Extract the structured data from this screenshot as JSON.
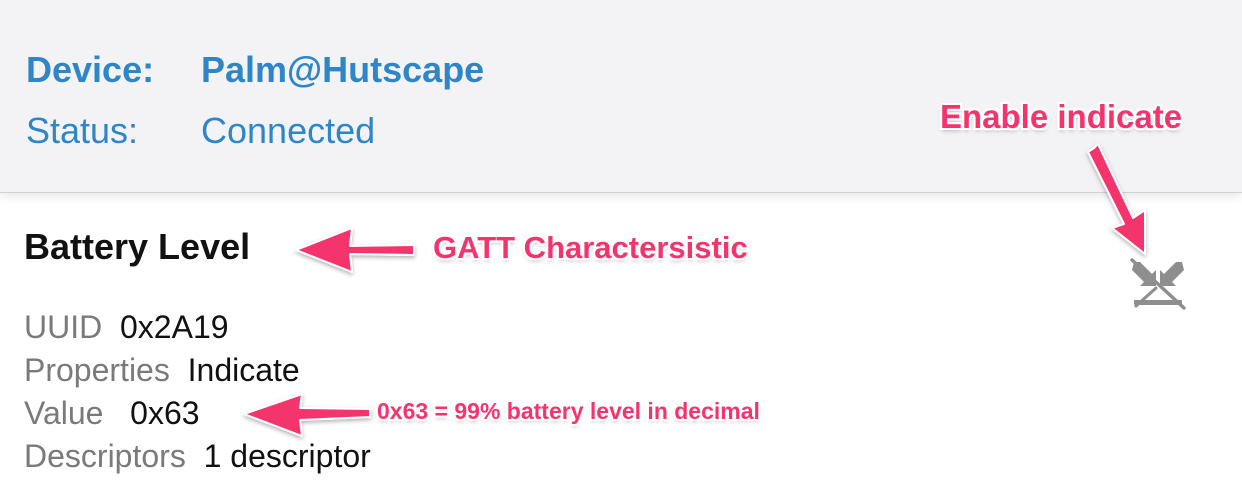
{
  "header": {
    "device_label": "Device:",
    "device_value": "Palm@Hutscape",
    "status_label": "Status:",
    "status_value": "Connected"
  },
  "characteristic": {
    "title": "Battery Level",
    "properties": [
      {
        "label": "UUID",
        "value": "0x2A19"
      },
      {
        "label": "Properties",
        "value": "Indicate"
      },
      {
        "label": "Value",
        "value": "0x63"
      },
      {
        "label": "Descriptors",
        "value": "1 descriptor"
      }
    ],
    "indicate_icon": "indicate-toggle-icon"
  },
  "annotations": {
    "enable_indicate": "Enable indicate",
    "gatt_characteristic": "GATT Charactersistic",
    "value_note": "0x63 = 99% battery level in decimal"
  },
  "colors": {
    "header_text": "#2e86c8",
    "header_bg": "#f3f3f5",
    "annotation": "#f4356d",
    "label_gray": "#7a7a7a",
    "icon_gray": "#8e8e8e"
  }
}
